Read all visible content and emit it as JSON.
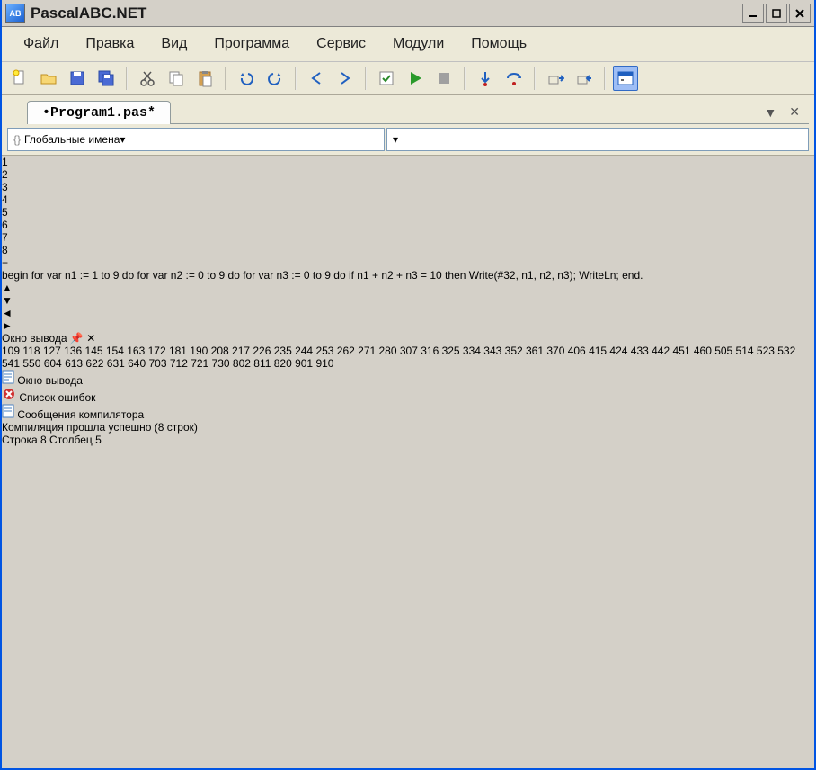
{
  "title": "PascalABC.NET",
  "menu": [
    "Файл",
    "Правка",
    "Вид",
    "Программа",
    "Сервис",
    "Модули",
    "Помощь"
  ],
  "tab": {
    "label": "•Program1.pas*"
  },
  "scope_combo": "Глобальные имена",
  "code_lines": [
    "1",
    "2",
    "3",
    "4",
    "5",
    "6",
    "7",
    "8"
  ],
  "code": {
    "l1": "begin",
    "l2": "  for var n1 := 1 to 9 do",
    "l3": "    for var n2 := 0 to 9 do",
    "l4": "      for var n3 := 0 to 9 do",
    "l5": "        if n1 + n2 + n3 = 10 then",
    "l6": "          Write(#32, n1, n2, n3);",
    "l7": "  WriteLn;",
    "l8": "end."
  },
  "output_title": "Окно вывода",
  "output_text": " 109 118 127 136 145 154 163 172 181 190 208 217 226 235 244 253 262 271 280 307 316 325 334 343 352 361 370 406 415 424 433 442 451 460 505 514 523 532 541 550 604 613 622 631 640 703 712 721 730 802 811 820 901 910",
  "bottom_tabs": {
    "output": "Окно вывода",
    "errors": "Список ошибок",
    "messages": "Сообщения компилятора"
  },
  "status": {
    "left": "Компиляция прошла успешно (8 строк)",
    "right": "Строка  8 Столбец  5"
  },
  "icons": {
    "titlebar": "AB"
  }
}
